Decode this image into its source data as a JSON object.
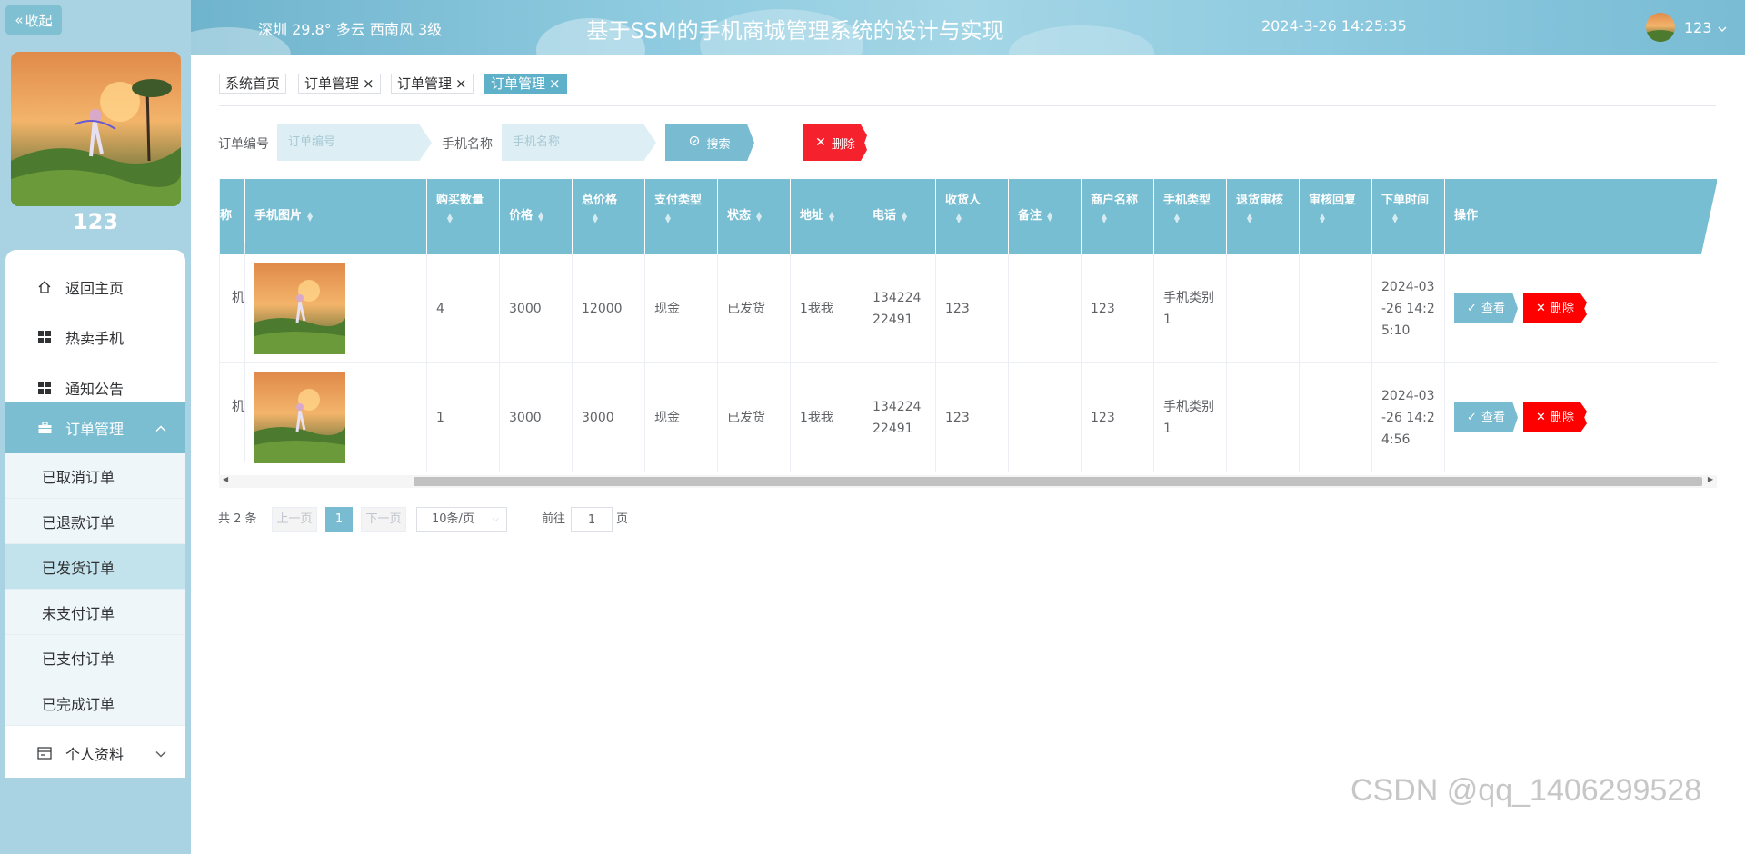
{
  "sidebar": {
    "collapse_label": "收起",
    "username": "123",
    "menu": [
      {
        "label": "返回主页",
        "icon": "home-icon"
      },
      {
        "label": "热卖手机",
        "icon": "grid-icon"
      },
      {
        "label": "通知公告",
        "icon": "grid-icon"
      },
      {
        "label": "订单管理",
        "icon": "briefcase-icon",
        "expanded": true
      },
      {
        "label": "个人资料",
        "icon": "id-card-icon",
        "expanded": false
      }
    ],
    "submenu": [
      {
        "label": "已取消订单"
      },
      {
        "label": "已退款订单"
      },
      {
        "label": "已发货订单",
        "active": true
      },
      {
        "label": "未支付订单"
      },
      {
        "label": "已支付订单"
      },
      {
        "label": "已完成订单"
      }
    ]
  },
  "header": {
    "weather": "深圳  29.8°  多云  西南风  3级",
    "title": "基于SSM的手机商城管理系统的设计与实现",
    "datetime": "2024-3-26 14:25:35",
    "username": "123"
  },
  "tabs": [
    {
      "label": "系统首页",
      "closable": false
    },
    {
      "label": "订单管理",
      "closable": true
    },
    {
      "label": "订单管理",
      "closable": true
    },
    {
      "label": "订单管理",
      "closable": true,
      "active": true
    }
  ],
  "tab_close": "×",
  "filters": {
    "order_no_label": "订单编号",
    "order_no_placeholder": "订单编号",
    "phone_name_label": "手机名称",
    "phone_name_placeholder": "手机名称",
    "search_label": "搜索",
    "delete_label": "删除"
  },
  "table": {
    "columns": [
      "称",
      "手机图片",
      "购买数量",
      "价格",
      "总价格",
      "支付类型",
      "状态",
      "地址",
      "电话",
      "收货人",
      "备注",
      "商户名称",
      "手机类型",
      "退货审核",
      "审核回复",
      "下单时间",
      "操作"
    ],
    "rows": [
      {
        "name": "机",
        "qty": "4",
        "price": "3000",
        "total": "12000",
        "pay_type": "现金",
        "status": "已发货",
        "address": "1我我",
        "phone": "13422422491",
        "receiver": "123",
        "remark": "",
        "merchant": "123",
        "phone_type": "手机类别1",
        "return_audit": "",
        "audit_reply": "",
        "order_time": "2024-03-26 14:25:10"
      },
      {
        "name": "机",
        "qty": "1",
        "price": "3000",
        "total": "3000",
        "pay_type": "现金",
        "status": "已发货",
        "address": "1我我",
        "phone": "13422422491",
        "receiver": "123",
        "remark": "",
        "merchant": "123",
        "phone_type": "手机类别1",
        "return_audit": "",
        "audit_reply": "",
        "order_time": "2024-03-26 14:24:56"
      }
    ],
    "view_label": "查看",
    "delete_label": "删除"
  },
  "pagination": {
    "total": "共 2 条",
    "prev": "上一页",
    "next": "下一页",
    "current": "1",
    "page_size": "10条/页",
    "goto_label": "前往",
    "goto_value": "1",
    "page_suffix": "页"
  },
  "watermark": "CSDN @qq_1406299528",
  "colors": {
    "accent": "#79bcd2",
    "danger": "#f5222d",
    "sidebar_bg": "#a9d3e2"
  }
}
